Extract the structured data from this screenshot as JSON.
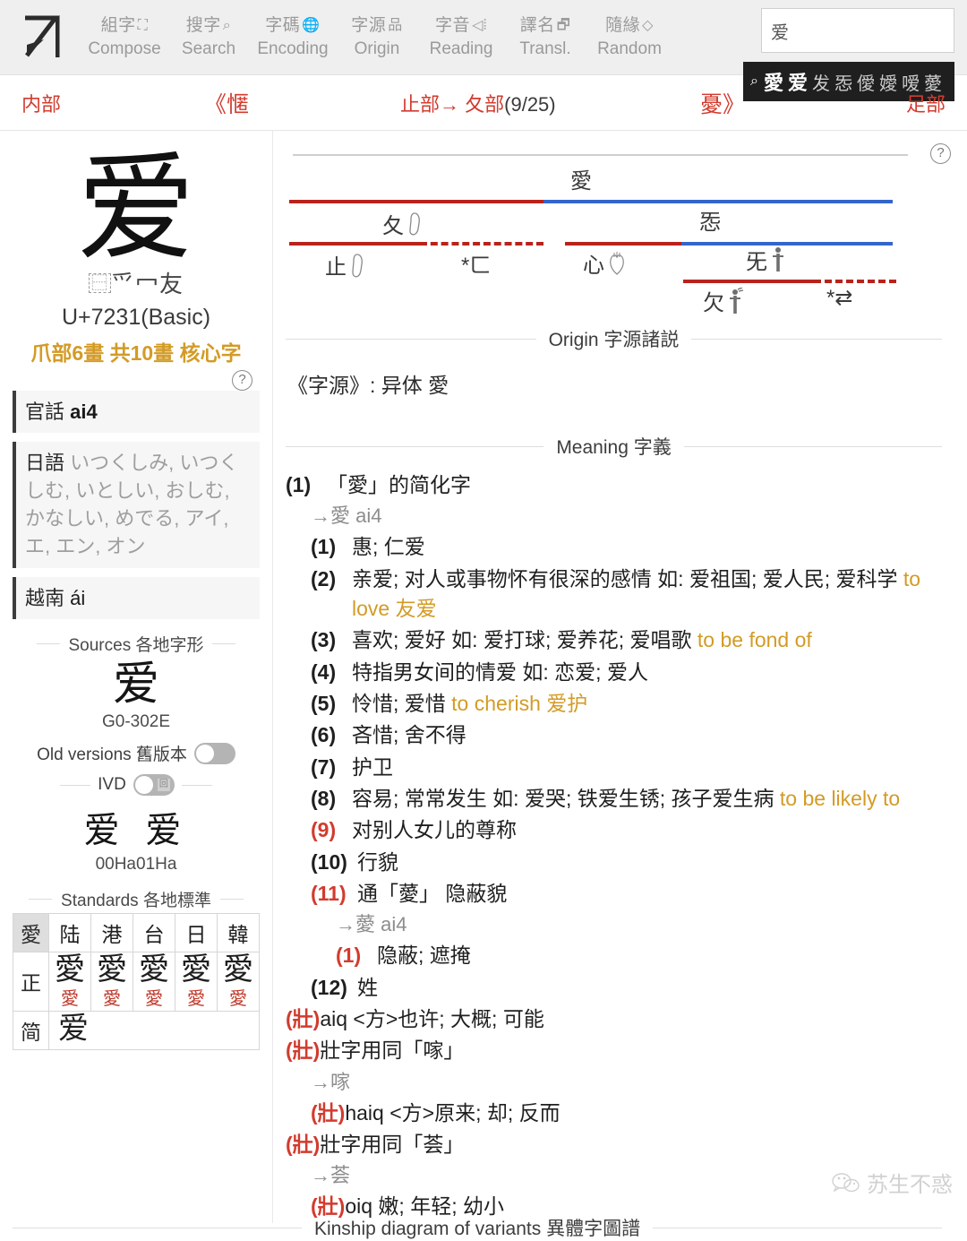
{
  "nav": {
    "logo": "Zi",
    "items": [
      {
        "cn": "組字",
        "glyph": "⛶",
        "en": "Compose",
        "name": "compose"
      },
      {
        "cn": "搜字",
        "glyph": "🔍",
        "en": "Search",
        "name": "search"
      },
      {
        "cn": "字碼",
        "glyph": "🌐",
        "en": "Encoding",
        "name": "encoding"
      },
      {
        "cn": "字源",
        "glyph": "品",
        "en": "Origin",
        "name": "origin"
      },
      {
        "cn": "字音",
        "glyph": "🔊",
        "en": "Reading",
        "name": "reading"
      },
      {
        "cn": "譯名",
        "glyph": "🗗",
        "en": "Transl.",
        "name": "transl"
      },
      {
        "cn": "隨緣",
        "glyph": "◇",
        "en": "Random",
        "name": "random"
      }
    ]
  },
  "search": {
    "value": "爱",
    "placeholder": "",
    "suggestion_icon": "search-icon",
    "suggestions": [
      "愛",
      "爱",
      "发",
      "㤅",
      "僾",
      "嬡",
      "嗳",
      "薆"
    ]
  },
  "charnav": {
    "internal": "内部",
    "prev": "《㥾",
    "mid_prefix": "止部→ ",
    "mid_radical": "夂部",
    "mid_count": "(9/25)",
    "next": "憂》",
    "foot": "足部"
  },
  "character": {
    "glyph": "爱",
    "decomposition_ideograph": "⿱",
    "decomposition_parts": "爫冖友",
    "codepoint": "U+7231(Basic)",
    "radical_info": "爪部6畫 共10畫 核心字",
    "help": "?"
  },
  "readings": [
    {
      "lang": "官話",
      "value": "ai4",
      "style": "mandarin"
    },
    {
      "lang": "日語",
      "value": "いつくしみ, いつくしむ, いとしい, おしむ, かなしい, めでる, アイ, エ, エン, オン",
      "style": "japanese"
    },
    {
      "lang": "越南",
      "value": "ái",
      "style": "vietnamese"
    }
  ],
  "sources": {
    "title": "Sources 各地字形",
    "glyph": "爱",
    "label": "G0-302E",
    "old_versions_label": "Old versions 舊版本",
    "ivd_label": "IVD",
    "ivd_glyphs": "爱 爱",
    "ivd_code": "00Ha01Ha"
  },
  "standards": {
    "title": "Standards 各地標準",
    "corner": "愛",
    "columns": [
      "陆",
      "港",
      "台",
      "日",
      "韓"
    ],
    "rows": [
      {
        "label": "正",
        "glyphs": [
          "愛",
          "愛",
          "愛",
          "愛",
          "愛"
        ],
        "alts": [
          "愛",
          "愛",
          "愛",
          "愛",
          "愛"
        ]
      },
      {
        "label": "简",
        "glyphs": [
          "爱",
          "",
          "",
          "",
          ""
        ],
        "alts": [
          "",
          "",
          "",
          "",
          ""
        ]
      }
    ]
  },
  "tree": {
    "help": "?",
    "root": "愛",
    "nodes": [
      {
        "label": "夂",
        "pict": "foot-icon",
        "glyph": "👣"
      },
      {
        "label": "㤅",
        "pict": "",
        "glyph": ""
      },
      {
        "label": "止",
        "pict": "foot-icon",
        "glyph": "👣"
      },
      {
        "label": "*ㄈ",
        "pict": "",
        "glyph": ""
      },
      {
        "label": "心",
        "pict": "heart-icon",
        "glyph": "🫀"
      },
      {
        "label": "旡",
        "pict": "person-icon",
        "glyph": "🧍"
      },
      {
        "label": "欠",
        "pict": "person-breath-icon",
        "glyph": "🧍"
      },
      {
        "label": "*⇄",
        "pict": "",
        "glyph": ""
      }
    ]
  },
  "sections": {
    "origin_title": "Origin 字源諸説",
    "meaning_title": "Meaning 字義",
    "kinship_title": "Kinship diagram of variants 異體字圖譜"
  },
  "origin": {
    "text": "《字源》: 异体 愛"
  },
  "meaning": {
    "head_num": "(1)",
    "head_text": "「愛」的简化字",
    "head_arrow": "→愛 ai4",
    "entries": [
      {
        "num": "(1)",
        "red": false,
        "text": "惠; 仁爱",
        "trans": ""
      },
      {
        "num": "(2)",
        "red": false,
        "text": "亲爱; 对人或事物怀有很深的感情 如: 爱祖国; 爱人民; 爱科学 ",
        "trans": "to love 友爱"
      },
      {
        "num": "(3)",
        "red": false,
        "text": "喜欢; 爱好 如: 爱打球; 爱养花; 爱唱歌 ",
        "trans": "to be fond of"
      },
      {
        "num": "(4)",
        "red": false,
        "text": "特指男女间的情爱 如: 恋爱; 爱人",
        "trans": ""
      },
      {
        "num": "(5)",
        "red": false,
        "text": "怜惜; 爱惜 ",
        "trans": "to cherish 爱护"
      },
      {
        "num": "(6)",
        "red": false,
        "text": "吝惜; 舍不得",
        "trans": ""
      },
      {
        "num": "(7)",
        "red": false,
        "text": "护卫",
        "trans": ""
      },
      {
        "num": "(8)",
        "red": false,
        "text": "容易; 常常发生 如: 爱哭; 铁爱生锈; 孩子爱生病 ",
        "trans": "to be likely to"
      },
      {
        "num": "(9)",
        "red": true,
        "text": "对别人女儿的尊称",
        "trans": ""
      },
      {
        "num": "(10)",
        "red": false,
        "text": "行貌",
        "trans": ""
      },
      {
        "num": "(11)",
        "red": true,
        "text": "通「薆」 隐蔽貌",
        "trans": ""
      }
    ],
    "sub_arrow": "→薆 ai4",
    "sub_entry_num": "(1)",
    "sub_entry_text": "隐蔽; 遮掩",
    "last_num": "(12)",
    "last_text": "姓",
    "zhuang": [
      {
        "tag": "(壯)",
        "text": "aiq <方>也许; 大概; 可能",
        "indent": 0
      },
      {
        "tag": "(壯)",
        "text": "壯字用同「𠺢」",
        "indent": 0
      },
      {
        "tag": "",
        "text": "→𠺢",
        "indent": 1,
        "grey": true
      },
      {
        "tag": "(壯)",
        "text": "haiq <方>原来; 却; 反而",
        "indent": 1
      },
      {
        "tag": "(壯)",
        "text": "壯字用同「荟」",
        "indent": 0
      },
      {
        "tag": "",
        "text": "→荟",
        "indent": 1,
        "grey": true
      },
      {
        "tag": "(壯)",
        "text": "oiq 嫩; 年轻; 幼小",
        "indent": 1
      }
    ]
  },
  "watermark": {
    "text": "苏生不惑"
  },
  "colors": {
    "red": "#d23b2e",
    "tree_red": "#b8231b",
    "tree_blue": "#3366cc",
    "orange": "#d39b26",
    "nav_bg": "#efefef",
    "suggest_bg": "#1f1f1f"
  }
}
